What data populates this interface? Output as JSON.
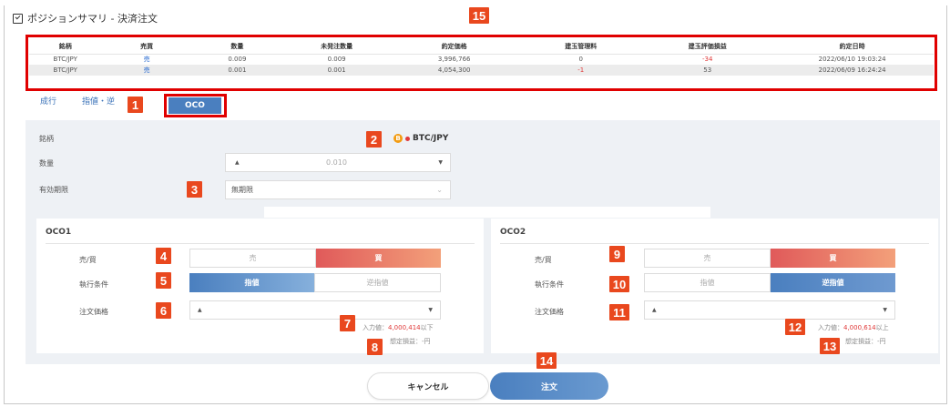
{
  "window": {
    "title": "ポジションサマリ - 決済注文"
  },
  "badges": [
    "1",
    "2",
    "3",
    "4",
    "5",
    "6",
    "7",
    "8",
    "9",
    "10",
    "11",
    "12",
    "13",
    "14",
    "15"
  ],
  "summary": {
    "headers": [
      "銘柄",
      "売買",
      "数量",
      "未発注数量",
      "約定価格",
      "建玉管理料",
      "建玉評価損益",
      "約定日時"
    ],
    "rows": [
      [
        "BTC/JPY",
        "売",
        "0.009",
        "0.009",
        "3,996,766",
        "0",
        "-34",
        "2022/06/10 19:03:24"
      ],
      [
        "BTC/JPY",
        "売",
        "0.001",
        "0.001",
        "4,054,300",
        "-1",
        "53",
        "2022/06/09 16:24:24"
      ]
    ]
  },
  "tabs": {
    "market": "成行",
    "limit_stop": "指値・逆",
    "oco": "OCO"
  },
  "form": {
    "symbol_label": "銘柄",
    "symbol_value": "BTC/JPY",
    "coin_glyph": "B",
    "qty_label": "数量",
    "qty_value": "0.010",
    "expiry_label": "有効期限",
    "expiry_value": "無期限"
  },
  "oco1": {
    "title": "OCO1",
    "side_label": "売/買",
    "sell": "売",
    "buy": "買",
    "cond_label": "執行条件",
    "limit": "指値",
    "stop": "逆指値",
    "price_label": "注文価格",
    "input_prefix": "入力値：",
    "input_value": "4,000,414",
    "input_suffix": "以下",
    "pnl": "想定損益：-円"
  },
  "oco2": {
    "title": "OCO2",
    "side_label": "売/買",
    "sell": "売",
    "buy": "買",
    "cond_label": "執行条件",
    "limit": "指値",
    "stop": "逆指値",
    "price_label": "注文価格",
    "input_prefix": "入力値：",
    "input_value": "4,000,614",
    "input_suffix": "以上",
    "pnl": "想定損益：-円"
  },
  "actions": {
    "cancel": "キャンセル",
    "order": "注文"
  },
  "colors": {
    "badge": "#e9481e",
    "highlight": "#e00000",
    "primary": "#4a7fbf",
    "buy": "#e05a5a",
    "sell_text": "#2b6cd1"
  },
  "icons": {
    "dropdown": "chevron-down-icon",
    "stepper_up": "triangle-up-icon",
    "stepper_down": "triangle-down-icon"
  }
}
